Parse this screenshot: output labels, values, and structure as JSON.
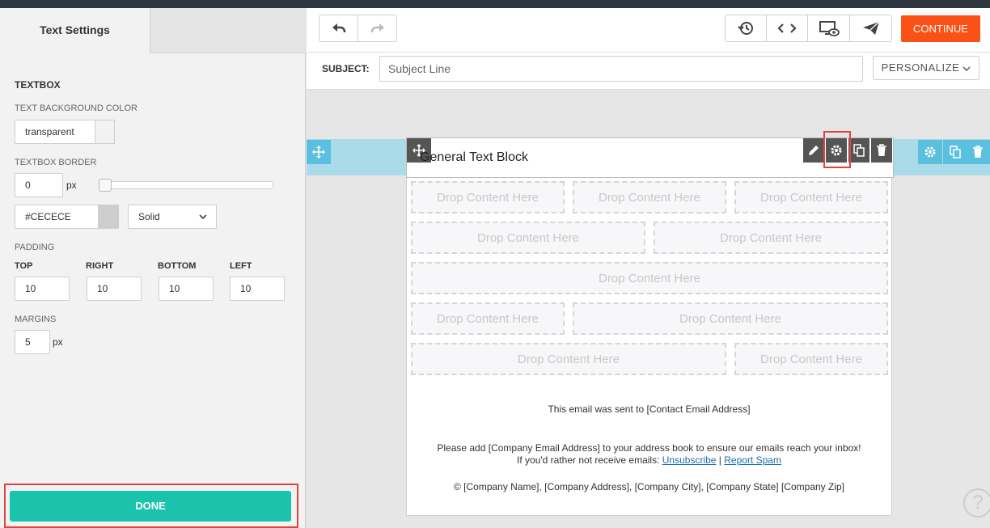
{
  "left_panel": {
    "tab_active": "Text Settings",
    "section_title": "TEXTBOX",
    "text_bg_label": "TEXT BACKGROUND COLOR",
    "text_bg_value": "transparent",
    "border_label": "TEXTBOX BORDER",
    "border_width": "0",
    "border_unit": "px",
    "border_color": "#CECECE",
    "border_style": "Solid",
    "padding_label": "PADDING",
    "padding": {
      "top_label": "TOP",
      "top": "10",
      "right_label": "RIGHT",
      "right": "10",
      "bottom_label": "BOTTOM",
      "bottom": "10",
      "left_label": "LEFT",
      "left": "10"
    },
    "margins_label": "MARGINS",
    "margins_value": "5",
    "margins_unit": "px",
    "done_label": "DONE"
  },
  "toolbar": {
    "continue_label": "CONTINUE"
  },
  "subject": {
    "label": "SUBJECT:",
    "placeholder": "Subject Line",
    "personalize_label": "PERSONALIZE"
  },
  "canvas": {
    "text_block_title": "General Text Block",
    "drop_label": "Drop Content Here",
    "footer_sent": "This email was sent to [Contact Email Address]",
    "footer_add": "Please add [Company Email Address] to your address book to ensure our emails reach your inbox!",
    "footer_rather": "If you'd rather not receive emails:",
    "unsubscribe": "Unsubscribe",
    "separator": "|",
    "report_spam": "Report Spam",
    "footer_company": "© [Company Name], [Company Address], [Company City], [Company State] [Company Zip]"
  },
  "help": "?",
  "colors": {
    "accent": "#1bc2ac",
    "continue": "#fa5116",
    "highlight": "#e0443e",
    "row_band": "#aadbe8"
  }
}
